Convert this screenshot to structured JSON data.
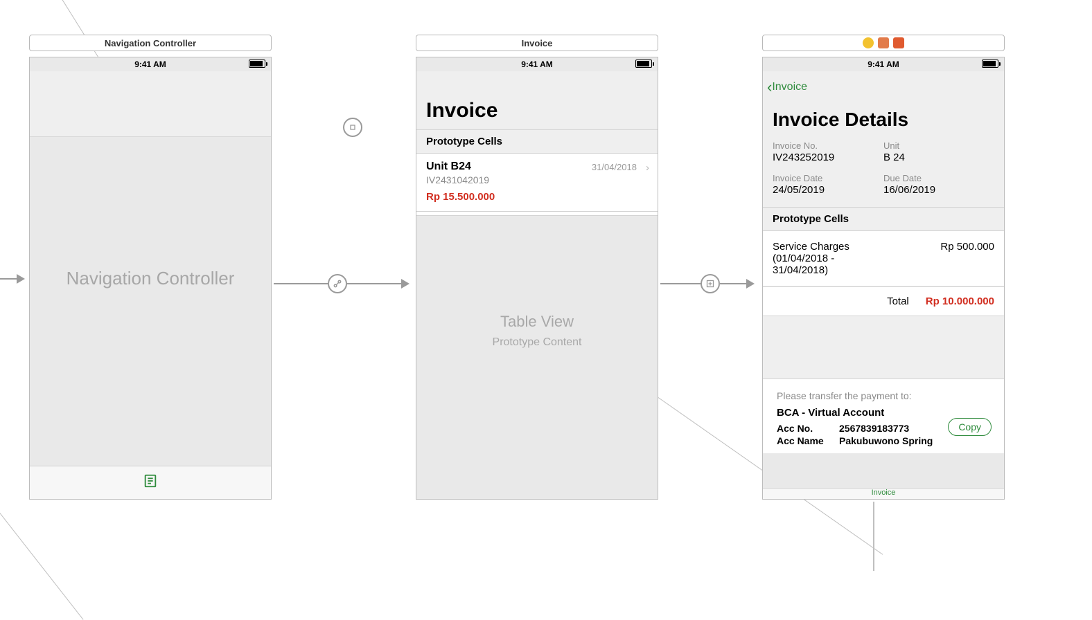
{
  "status": {
    "time": "9:41 AM"
  },
  "scene1": {
    "title": "Navigation Controller",
    "placeholder": "Navigation Controller"
  },
  "scene2": {
    "title": "Invoice",
    "heading": "Invoice",
    "sectionHeader": "Prototype Cells",
    "cell": {
      "unit": "Unit B24",
      "invoiceId": "IV2431042019",
      "date": "31/04/2018",
      "price": "Rp 15.500.000"
    },
    "placeholder1": "Table View",
    "placeholder2": "Prototype Content"
  },
  "scene3": {
    "backLabel": "Invoice",
    "heading": "Invoice Details",
    "fields": {
      "invoiceNoLabel": "Invoice No.",
      "invoiceNo": "IV243252019",
      "unitLabel": "Unit",
      "unit": "B 24",
      "invoiceDateLabel": "Invoice Date",
      "invoiceDate": "24/05/2019",
      "dueDateLabel": "Due Date",
      "dueDate": "16/06/2019"
    },
    "sectionHeader": "Prototype Cells",
    "charge": {
      "name": "Service Charges (01/04/2018 - 31/04/2018)",
      "amount": "Rp 500.000"
    },
    "totalLabel": "Total",
    "totalValue": "Rp 10.000.000",
    "payment": {
      "note": "Please transfer the payment to:",
      "bank": "BCA - Virtual Account",
      "accNoLabel": "Acc No.",
      "accNo": "2567839183773",
      "accNameLabel": "Acc Name",
      "accName": "Pakubuwono Spring",
      "copy": "Copy"
    },
    "tabLabel": "Invoice"
  }
}
